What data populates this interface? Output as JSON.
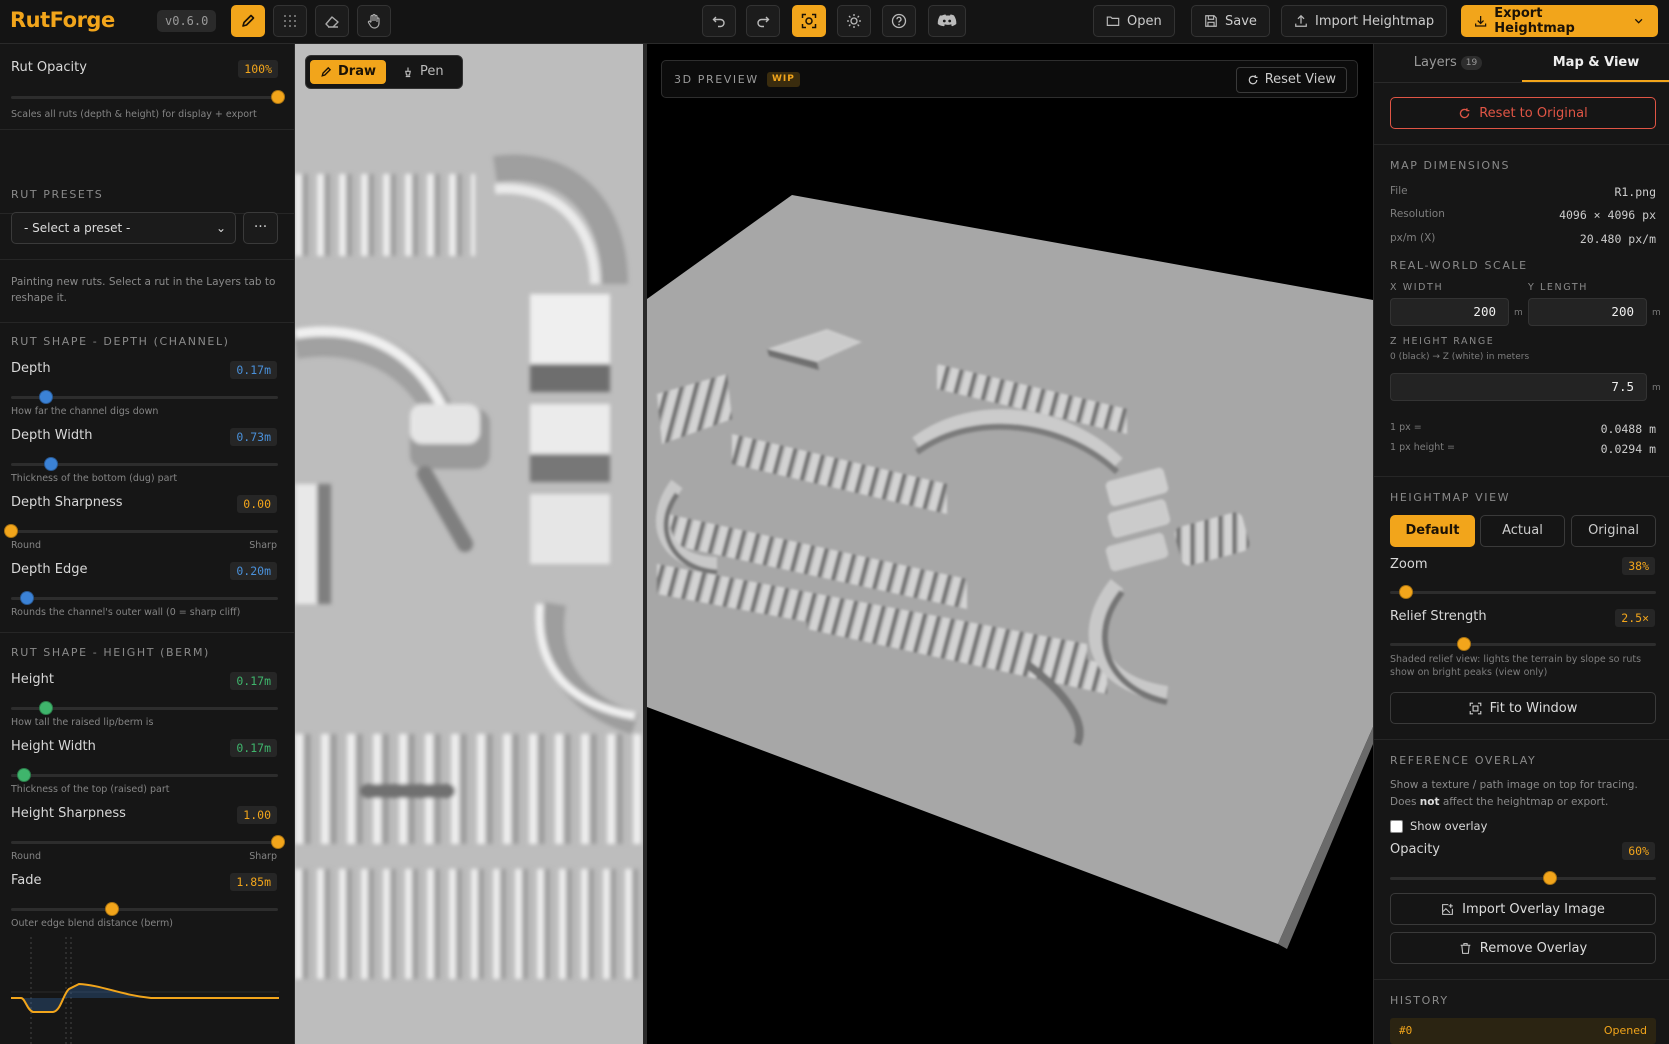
{
  "app": {
    "name": "RutForge",
    "version": "v0.6.0"
  },
  "topbar": {
    "open_label": "Open",
    "save_label": "Save",
    "import_label": "Import Heightmap",
    "export_label": "Export Heightmap"
  },
  "left": {
    "rut_opacity": {
      "label": "Rut Opacity",
      "value": "100%",
      "fraction": 1.0,
      "hint": "Scales all ruts (depth & height) for display + export"
    },
    "presets": {
      "heading": "RUT PRESETS",
      "selected": "- Select a preset -",
      "more": "···"
    },
    "info": "Painting new ruts. Select a rut in the Layers tab to reshape it.",
    "depth_heading": "RUT SHAPE - DEPTH (CHANNEL)",
    "depth": {
      "label": "Depth",
      "value": "0.17m",
      "fraction": 0.13,
      "hint": "How far the channel digs down"
    },
    "depth_width": {
      "label": "Depth Width",
      "value": "0.73m",
      "fraction": 0.15,
      "hint": "Thickness of the bottom (dug) part"
    },
    "depth_sharpness": {
      "label": "Depth Sharpness",
      "value": "0.00",
      "fraction": 0.0,
      "hint_left": "Round",
      "hint_right": "Sharp"
    },
    "depth_edge": {
      "label": "Depth Edge",
      "value": "0.20m",
      "fraction": 0.06,
      "hint": "Rounds the channel's outer wall (0 = sharp cliff)"
    },
    "height_heading": "RUT SHAPE - HEIGHT (BERM)",
    "height": {
      "label": "Height",
      "value": "0.17m",
      "fraction": 0.13,
      "hint": "How tall the raised lip/berm is"
    },
    "height_width": {
      "label": "Height Width",
      "value": "0.17m",
      "fraction": 0.05,
      "hint": "Thickness of the top (raised) part"
    },
    "height_sharpness": {
      "label": "Height Sharpness",
      "value": "1.00",
      "fraction": 1.0,
      "hint_left": "Round",
      "hint_right": "Sharp"
    },
    "fade": {
      "label": "Fade",
      "value": "1.85m",
      "fraction": 0.38,
      "hint": "Outer edge blend distance (berm)"
    }
  },
  "canvas2d": {
    "draw_label": "Draw",
    "pen_label": "Pen"
  },
  "preview": {
    "title": "3D PREVIEW",
    "badge": "WIP",
    "reset_label": "Reset View"
  },
  "right": {
    "tabs": {
      "layers": "Layers",
      "layers_count": "19",
      "map": "Map & View"
    },
    "reset_original": "Reset to Original",
    "dims": {
      "heading": "MAP DIMENSIONS",
      "file_label": "File",
      "file_value": "R1.png",
      "res_label": "Resolution",
      "res_value": "4096 × 4096 px",
      "pxm_label": "px/m (X)",
      "pxm_value": "20.480 px/m"
    },
    "scale": {
      "heading": "REAL-WORLD SCALE",
      "x_label": "X WIDTH",
      "y_label": "Y LENGTH",
      "x_value": "200",
      "y_value": "200",
      "unit": "m",
      "z_label": "Z HEIGHT RANGE",
      "z_hint": "0 (black) → Z (white) in meters",
      "z_value": "7.5",
      "px_label": "1 px =",
      "px_value": "0.0488 m",
      "pxh_label": "1 px height =",
      "pxh_value": "0.0294 m"
    },
    "view": {
      "heading": "HEIGHTMAP VIEW",
      "default": "Default",
      "actual": "Actual",
      "original": "Original",
      "zoom_label": "Zoom",
      "zoom_value": "38%",
      "zoom_fraction": 0.06,
      "relief_label": "Relief Strength",
      "relief_value": "2.5×",
      "relief_fraction": 0.28,
      "relief_hint": "Shaded relief view: lights the terrain by slope so ruts show on bright peaks (view only)",
      "fit_label": "Fit to Window"
    },
    "overlay": {
      "heading": "REFERENCE OVERLAY",
      "desc_a": "Show a texture / path image on top for tracing. Does ",
      "desc_b": "not",
      "desc_c": " affect the heightmap or export.",
      "show_label": "Show overlay",
      "opacity_label": "Opacity",
      "opacity_value": "60%",
      "opacity_fraction": 0.6,
      "import_label": "Import Overlay Image",
      "remove_label": "Remove Overlay"
    },
    "history": {
      "heading": "HISTORY",
      "id": "#0",
      "action": "Opened"
    }
  },
  "colors": {
    "accent": "#f2a51b",
    "depth": "#3b82d6",
    "height": "#3fb56c",
    "danger": "#e05545"
  }
}
